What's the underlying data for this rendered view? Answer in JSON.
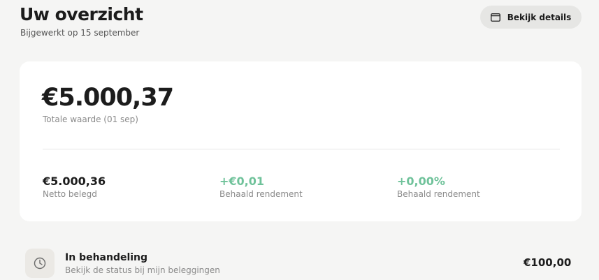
{
  "header": {
    "title": "Uw overzicht",
    "updated": "Bijgewerkt op 15 september",
    "details_button": "Bekijk details",
    "details_icon": "window-icon"
  },
  "summary": {
    "total_value": "€5.000,37",
    "total_label": "Totale waarde (01 sep)",
    "stats": [
      {
        "value": "€5.000,36",
        "label": "Netto belegd"
      },
      {
        "value": "+€0,01",
        "label": "Behaald rendement"
      },
      {
        "value": "+0,00%",
        "label": "Behaald rendement"
      }
    ],
    "positive_color": "#6fc29a"
  },
  "pending": {
    "icon": "clock-icon",
    "title": "In behandeling",
    "subtitle": "Bekijk de status bij mijn beleggingen",
    "amount": "€100,00"
  }
}
